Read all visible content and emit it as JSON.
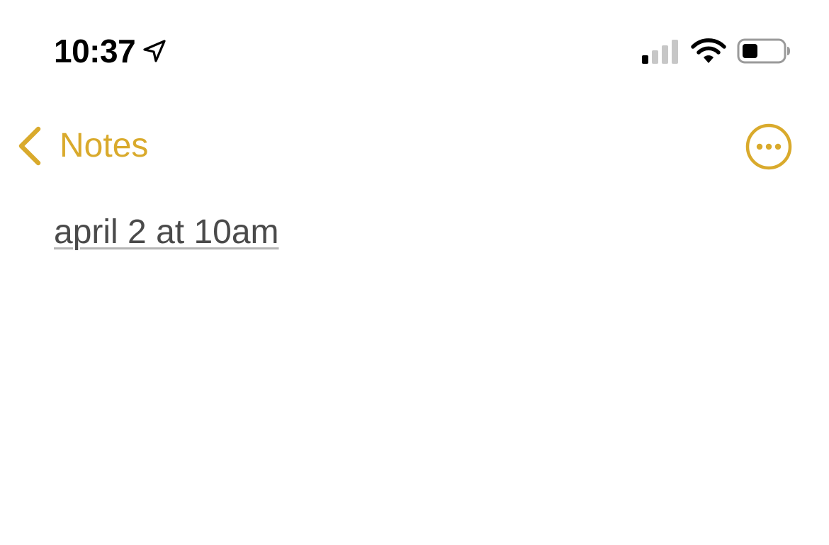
{
  "status_bar": {
    "time": "10:37",
    "location_icon": "location-arrow-icon",
    "signal_icon": "cellular-signal-icon",
    "signal_bars_active": 1,
    "signal_bars_total": 4,
    "wifi_icon": "wifi-icon",
    "battery_icon": "battery-icon",
    "battery_level": 0.35
  },
  "nav_bar": {
    "back_icon": "chevron-left-icon",
    "back_label": "Notes",
    "more_icon": "ellipsis-circle-icon"
  },
  "note": {
    "lines": [
      {
        "text": "april 2 at 10am",
        "is_detected_date_link": true
      }
    ]
  },
  "colors": {
    "accent": "#d9aa2c",
    "text": "#4a4a4a",
    "link_underline": "#b5b5b5",
    "background": "#ffffff",
    "status_text": "#000000"
  }
}
